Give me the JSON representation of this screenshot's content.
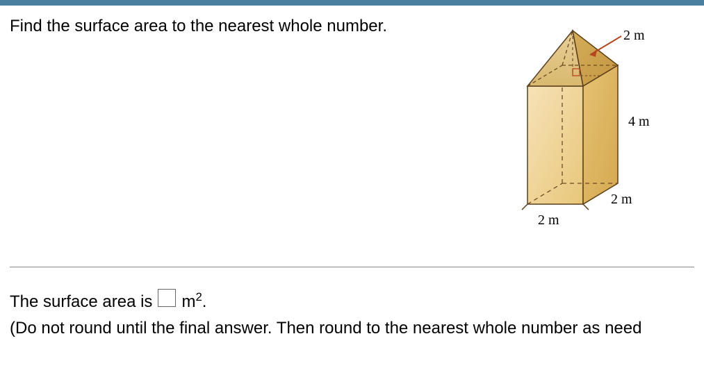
{
  "problem": {
    "prompt": "Find the surface area to the nearest whole number.",
    "figure": {
      "labels": {
        "slant_height": "2 m",
        "prism_height": "4 m",
        "base_depth": "2 m",
        "base_width": "2 m"
      }
    }
  },
  "answer": {
    "lead": "The surface area is",
    "unit_base": "m",
    "unit_exp": "2",
    "period": ".",
    "hint": "(Do not round until the final answer. Then round to the nearest whole number as need"
  }
}
